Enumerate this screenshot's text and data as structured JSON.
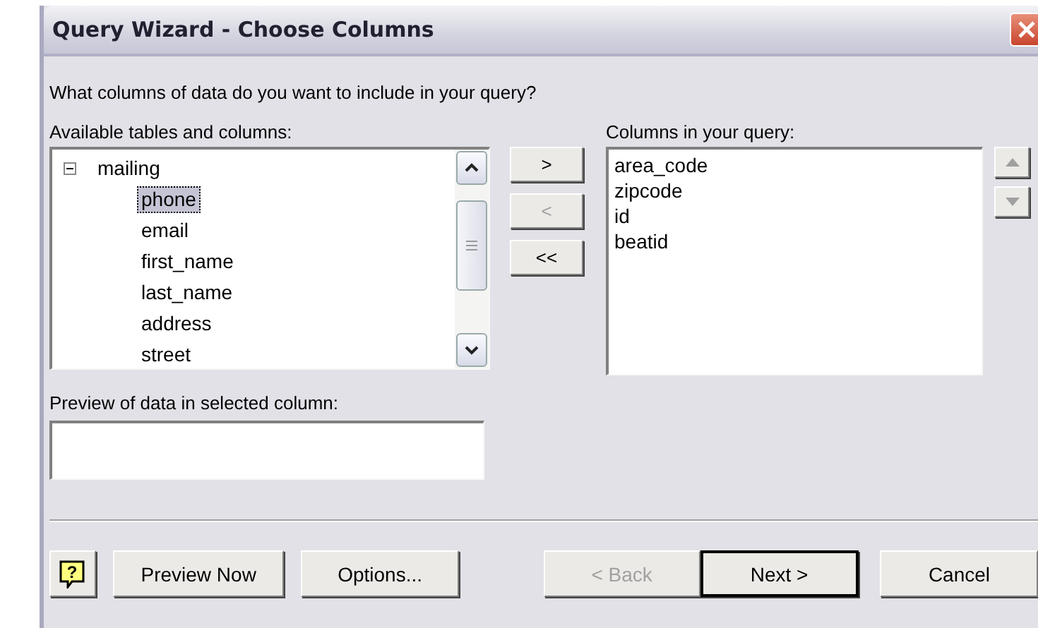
{
  "window": {
    "title": "Query Wizard - Choose Columns"
  },
  "question": "What columns of data do you want to include in your query?",
  "available": {
    "label": "Available tables and columns:",
    "tree": [
      {
        "label": "mailing",
        "expanded": true,
        "selected": false,
        "children": [
          {
            "label": "phone",
            "selected": true
          },
          {
            "label": "email",
            "selected": false
          },
          {
            "label": "first_name",
            "selected": false
          },
          {
            "label": "last_name",
            "selected": false
          },
          {
            "label": "address",
            "selected": false
          },
          {
            "label": "street",
            "selected": false
          }
        ]
      }
    ]
  },
  "move_buttons": [
    {
      "label": ">",
      "disabled": false
    },
    {
      "label": "<",
      "disabled": true
    },
    {
      "label": "<<",
      "disabled": false
    }
  ],
  "query_columns": {
    "label": "Columns in your query:",
    "items": [
      {
        "label": "area_code",
        "selected": false
      },
      {
        "label": "zipcode",
        "selected": false
      },
      {
        "label": "id",
        "selected": false
      },
      {
        "label": "beatid",
        "selected": false
      }
    ]
  },
  "order_buttons": [
    {
      "kind": "up",
      "disabled": true
    },
    {
      "kind": "down",
      "disabled": true
    }
  ],
  "preview": {
    "label": "Preview of data in selected column:"
  },
  "buttons": [
    {
      "kind": "help",
      "label": "?"
    },
    {
      "kind": "text",
      "label": "Preview Now",
      "disabled": false,
      "default": false
    },
    {
      "kind": "text",
      "label": "Options...",
      "disabled": false,
      "default": false
    },
    {
      "kind": "spacer"
    },
    {
      "kind": "text",
      "label": "< Back",
      "disabled": true,
      "default": false
    },
    {
      "kind": "text",
      "label": "Next >",
      "disabled": false,
      "default": true
    },
    {
      "kind": "gap"
    },
    {
      "kind": "text",
      "label": "Cancel",
      "disabled": false,
      "default": false
    }
  ]
}
